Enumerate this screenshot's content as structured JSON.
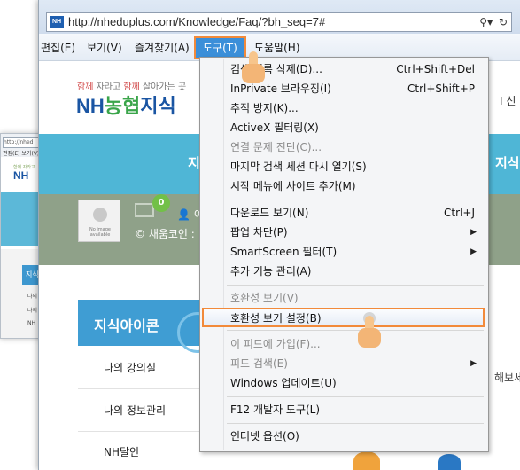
{
  "background_window": {
    "url": "http://nhed",
    "menu": "편집(E) 보기(V)",
    "tagline": "함께 자라고",
    "logo": "NH",
    "side_title": "지식",
    "side_items": [
      "나의",
      "나의",
      "NH"
    ]
  },
  "browser": {
    "url": "http://nheduplus.com/Knowledge/Faq/?bh_seq=7#",
    "site_icon": "NH",
    "addr_tools": [
      "search-icon",
      "refresh-icon"
    ],
    "menubar": [
      {
        "label": "편집(E)",
        "active": false
      },
      {
        "label": "보기(V)",
        "active": false
      },
      {
        "label": "즐겨찾기(A)",
        "active": false
      },
      {
        "label": "도구(T)",
        "active": true
      },
      {
        "label": "도움말(H)",
        "active": false
      }
    ]
  },
  "page": {
    "tagline_a": "함께",
    "tagline_b": " 자라고 ",
    "tagline_c": "함께",
    "tagline_d": " 살아가는 곳",
    "logo_a": "NH",
    "logo_b": "농협",
    "logo_c": "지식",
    "right_text": "I 신 ㅎ",
    "band_title": "지",
    "band_right": "지식나",
    "badge_count": "0",
    "user_text": "이",
    "coin_text": "© 채움코인 :",
    "avatar_caption": "No image available",
    "knowledge_icon_title": "지식아이콘",
    "side_items": [
      "나의 강의실",
      "나의 정보관리",
      "NH달인"
    ],
    "right_snip": "해보세"
  },
  "tools_menu": {
    "items": [
      {
        "label": "검색 기록 삭제(D)...",
        "shortcut": "Ctrl+Shift+Del",
        "disabled": false
      },
      {
        "label": "InPrivate 브라우징(I)",
        "shortcut": "Ctrl+Shift+P",
        "disabled": false
      },
      {
        "label": "추적 방지(K)...",
        "shortcut": "",
        "disabled": false
      },
      {
        "label": "ActiveX 필터링(X)",
        "shortcut": "",
        "disabled": false
      },
      {
        "label": "연결 문제 진단(C)...",
        "shortcut": "",
        "disabled": true
      },
      {
        "label": "마지막 검색 세션 다시 열기(S)",
        "shortcut": "",
        "disabled": false
      },
      {
        "label": "시작 메뉴에 사이트 추가(M)",
        "shortcut": "",
        "disabled": false
      },
      {
        "label": "다운로드 보기(N)",
        "shortcut": "Ctrl+J",
        "disabled": false
      },
      {
        "label": "팝업 차단(P)",
        "shortcut": "",
        "submenu": true,
        "disabled": false
      },
      {
        "label": "SmartScreen 필터(T)",
        "shortcut": "",
        "submenu": true,
        "disabled": false
      },
      {
        "label": "추가 기능 관리(A)",
        "shortcut": "",
        "disabled": false
      },
      {
        "label": "호환성 보기(V)",
        "shortcut": "",
        "disabled": true
      },
      {
        "label": "호환성 보기 설정(B)",
        "shortcut": "",
        "disabled": false,
        "highlighted": true
      },
      {
        "label": "이 피드에 가입(F)...",
        "shortcut": "",
        "disabled": true
      },
      {
        "label": "피드 검색(E)",
        "shortcut": "",
        "submenu": true,
        "disabled": true
      },
      {
        "label": "Windows 업데이트(U)",
        "shortcut": "",
        "disabled": false
      },
      {
        "label": "F12 개발자 도구(L)",
        "shortcut": "",
        "disabled": false
      },
      {
        "label": "인터넷 옵션(O)",
        "shortcut": "",
        "disabled": false
      }
    ]
  },
  "colors": {
    "highlight_border": "#f28a3a",
    "active_menu": "#3b8fd9",
    "brand_blue": "#1a55a3",
    "band": "#4fb6d6"
  }
}
